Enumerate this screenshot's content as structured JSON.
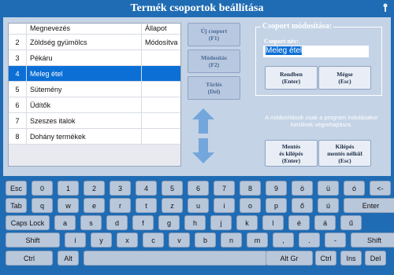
{
  "window": {
    "title": "Termék csoportok beállítása"
  },
  "table": {
    "headers": {
      "num": "",
      "name": "Megnevezés",
      "status": "Állapot"
    },
    "rows": [
      {
        "num": "2",
        "name": "Zöldség gyümölcs",
        "status": "Módosítva",
        "selected": false
      },
      {
        "num": "3",
        "name": "Pékáru",
        "status": "",
        "selected": false
      },
      {
        "num": "4",
        "name": "Meleg étel",
        "status": "",
        "selected": true
      },
      {
        "num": "5",
        "name": "Sütemény",
        "status": "",
        "selected": false
      },
      {
        "num": "6",
        "name": "Üdítők",
        "status": "",
        "selected": false
      },
      {
        "num": "7",
        "name": "Szeszes italok",
        "status": "",
        "selected": false
      },
      {
        "num": "8",
        "name": "Dohány termékek",
        "status": "",
        "selected": false
      }
    ]
  },
  "side_buttons": {
    "new": {
      "line1": "Új csoport",
      "line2": "(F1)"
    },
    "modify": {
      "line1": "Módosítás",
      "line2": "(F2)"
    },
    "delete": {
      "line1": "Törlés",
      "line2": "(Del)"
    }
  },
  "group": {
    "title": "Csoport módosítása:",
    "name_label": "Csoport név:",
    "name_value": "Meleg étel",
    "ok": {
      "line1": "Rendben",
      "line2": "(Enter)"
    },
    "cancel": {
      "line1": "Mégse",
      "line2": "(Esc)"
    }
  },
  "notice": "A módosítások csak a program indulásakor kerülnek végrehajtásra.",
  "bottom_buttons": {
    "save_exit": {
      "line1": "Mentés",
      "line2": "és kilépés",
      "line3": "(Enter)"
    },
    "exit_nosave": {
      "line1": "Kilépés",
      "line2": "mentés nélkül",
      "line3": "(Esc)"
    }
  },
  "keyboard": {
    "row1": [
      "Esc",
      "0",
      "1",
      "2",
      "3",
      "4",
      "5",
      "6",
      "7",
      "8",
      "9",
      "ö",
      "ü",
      "ó",
      "<-"
    ],
    "row2": [
      "Tab",
      "q",
      "w",
      "e",
      "r",
      "t",
      "z",
      "u",
      "i",
      "o",
      "p",
      "ő",
      "ú",
      "Enter"
    ],
    "row3": [
      "Caps Lock",
      "a",
      "s",
      "d",
      "f",
      "g",
      "h",
      "j",
      "k",
      "l",
      "é",
      "á",
      "ű"
    ],
    "row4": [
      "Shift",
      "í",
      "y",
      "x",
      "c",
      "v",
      "b",
      "n",
      "m",
      ",",
      ".",
      "-",
      "Shift"
    ],
    "row5": [
      "Ctrl",
      "Alt",
      "",
      "Alt Gr",
      "Ctrl",
      "Ins",
      "Del"
    ]
  },
  "colors": {
    "background": "#1f6cb4",
    "panel": "#c4d3e6",
    "selection": "#0b6fd6"
  }
}
